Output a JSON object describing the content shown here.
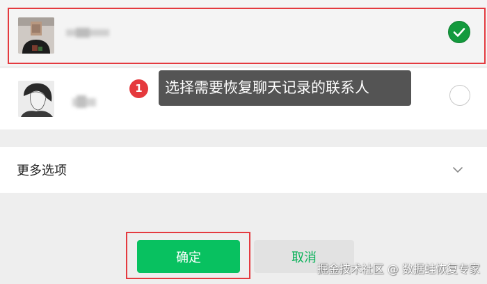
{
  "contacts": [
    {
      "name": "",
      "selected": true,
      "avatar": "avatar-person-1"
    },
    {
      "name": "",
      "selected": false,
      "avatar": "avatar-person-2"
    }
  ],
  "annotation": {
    "step_number": "1",
    "tooltip_text": "选择需要恢复聊天记录的联系人"
  },
  "more_options": {
    "label": "更多选项",
    "icon": "chevron-down-icon"
  },
  "buttons": {
    "confirm_label": "确定",
    "cancel_label": "取消"
  },
  "watermark": {
    "text": "掘金技术社区 @ 数据蛙恢复专家"
  },
  "colors": {
    "accent_green": "#08c160",
    "check_green": "#139a3d",
    "highlight_red": "#e43a3f",
    "tooltip_bg": "#545454"
  }
}
